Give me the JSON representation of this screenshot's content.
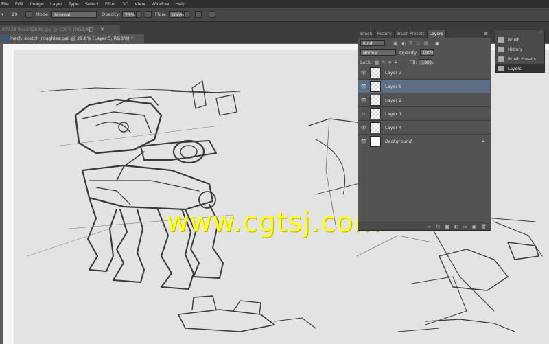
{
  "menubar": {
    "items": [
      "File",
      "Edit",
      "Image",
      "Layer",
      "Type",
      "Select",
      "Filter",
      "3D",
      "View",
      "Window",
      "Help"
    ]
  },
  "options": {
    "brush_size": "29",
    "mode_label": "Mode:",
    "mode_value": "Normal",
    "opacity_label": "Opacity:",
    "opacity_value": "73%",
    "flow_label": "Flow:",
    "flow_value": "100%"
  },
  "documents": {
    "tab_inactive": "87338 8ba6828B9.jpg @ 100% (RGB/8) *",
    "tab_active": "mech_sketch_roughies.psd @ 29.8% (Layer 5, RGB/8) *"
  },
  "watermark": "www.cgtsj.com",
  "layers_panel": {
    "tabs": [
      "Brush",
      "History",
      "Brush Presets",
      "Layers"
    ],
    "filter_kind": "Kind",
    "blend_mode": "Normal",
    "opacity_label": "Opacity:",
    "opacity_value": "100%",
    "lock_label": "Lock:",
    "fill_label": "Fill:",
    "fill_value": "100%",
    "layers": [
      {
        "name": "Layer 3",
        "visible": true,
        "selected": false
      },
      {
        "name": "Layer 5",
        "visible": true,
        "selected": true
      },
      {
        "name": "Layer 2",
        "visible": true,
        "selected": false
      },
      {
        "name": "Layer 1",
        "visible": false,
        "selected": false
      },
      {
        "name": "Layer 4",
        "visible": true,
        "selected": false
      },
      {
        "name": "Background",
        "visible": true,
        "selected": false,
        "locked": true
      }
    ],
    "footer_icons": [
      "link-icon",
      "fx-icon",
      "mask-icon",
      "adjustment-icon",
      "group-icon",
      "new-layer-icon",
      "trash-icon"
    ]
  },
  "dock": {
    "items": [
      "Brush",
      "History",
      "Brush Presets",
      "Layers"
    ]
  },
  "colors": {
    "accent_selected": "#5b6e84",
    "watermark": "#ffff1a"
  }
}
